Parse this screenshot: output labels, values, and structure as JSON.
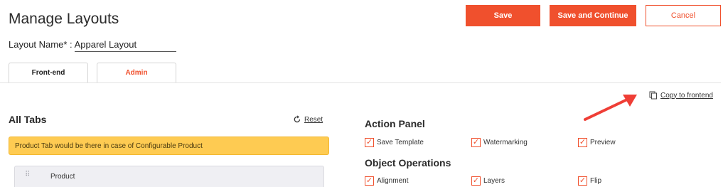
{
  "header": {
    "title": "Manage Layouts",
    "save_label": "Save",
    "save_continue_label": "Save and Continue",
    "cancel_label": "Cancel"
  },
  "layout_name": {
    "label": "Layout Name* :",
    "value": "Apparel Layout"
  },
  "tabs": [
    {
      "label": "Front-end",
      "active": true
    },
    {
      "label": "Admin",
      "active": false
    }
  ],
  "copy_link": {
    "label": "Copy to frontend",
    "icon": "copy-icon"
  },
  "all_tabs": {
    "title": "All Tabs",
    "reset_label": "Reset",
    "notice": "Product Tab would be there in case of Configurable Product",
    "items": [
      {
        "label": "Product"
      }
    ]
  },
  "action_panel": {
    "title": "Action Panel",
    "options": [
      {
        "label": "Save Template",
        "checked": true
      },
      {
        "label": "Watermarking",
        "checked": true
      },
      {
        "label": "Preview",
        "checked": true
      }
    ]
  },
  "object_operations": {
    "title": "Object Operations",
    "options": [
      {
        "label": "Alignment",
        "checked": true
      },
      {
        "label": "Layers",
        "checked": true
      },
      {
        "label": "Flip",
        "checked": true
      }
    ]
  },
  "colors": {
    "accent": "#f0502d",
    "notice_bg": "#fecb52",
    "arrow": "#ef3e36"
  }
}
